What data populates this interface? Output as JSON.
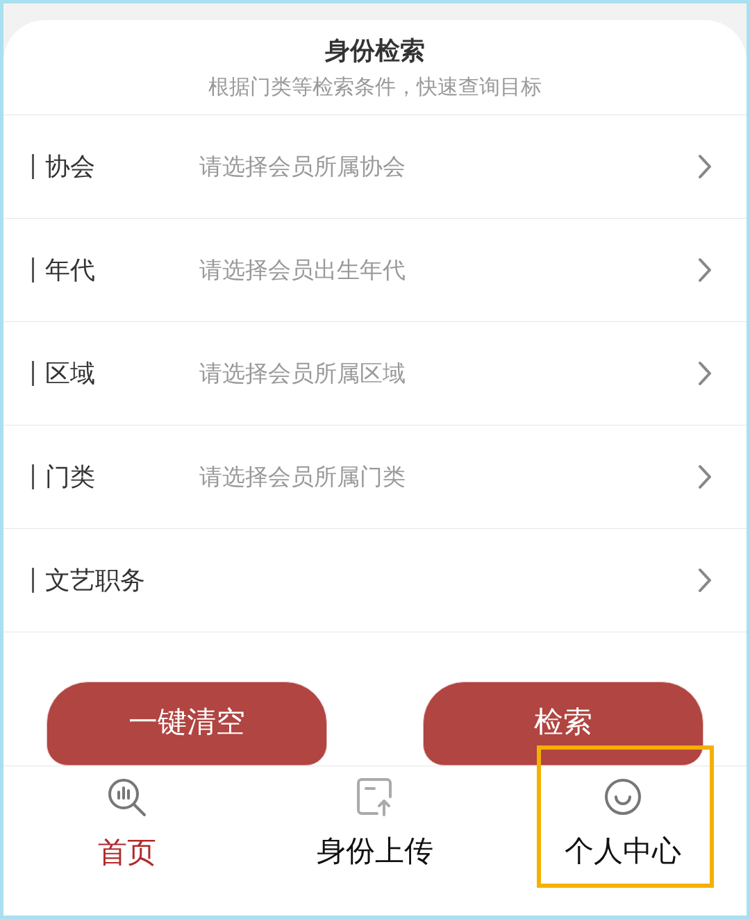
{
  "header": {
    "title": "身份检索",
    "subtitle": "根据门类等检索条件，快速查询目标"
  },
  "fields": [
    {
      "label": "协会",
      "placeholder": "请选择会员所属协会"
    },
    {
      "label": "年代",
      "placeholder": "请选择会员出生年代"
    },
    {
      "label": "区域",
      "placeholder": "请选择会员所属区域"
    },
    {
      "label": "门类",
      "placeholder": "请选择会员所属门类"
    },
    {
      "label": "文艺职务"
    }
  ],
  "buttons": [
    "一键清空",
    "检索"
  ],
  "nav": [
    {
      "label": "首页",
      "kind": "home",
      "selected": true,
      "highlighted": false
    },
    {
      "label": "身份上传",
      "kind": "upload",
      "selected": false,
      "highlighted": false
    },
    {
      "label": "个人中心",
      "kind": "profile",
      "selected": false,
      "highlighted": true
    }
  ]
}
